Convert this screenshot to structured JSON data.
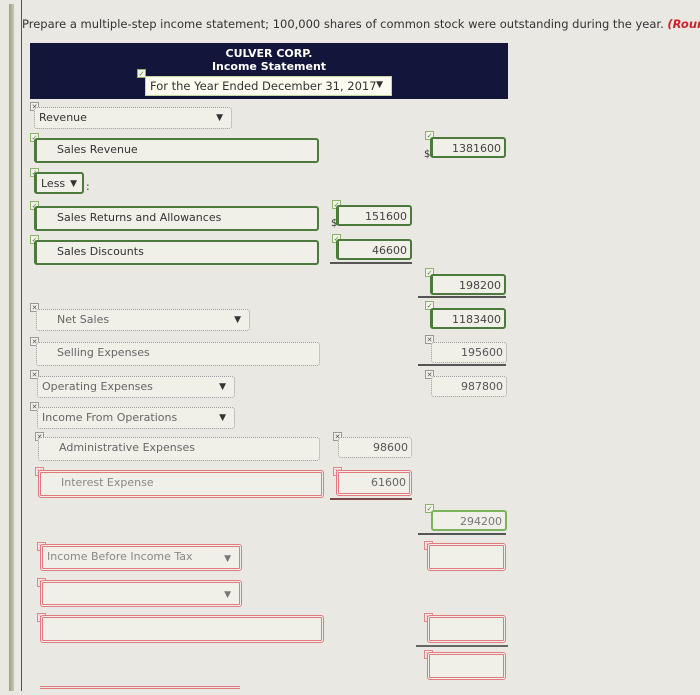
{
  "instructions": {
    "text": "Prepare a multiple-step income statement; 100,000 shares of common stock were outstanding during the year.",
    "note": "(Round earni"
  },
  "header": {
    "company": "CULVER CORP.",
    "statement": "Income Statement",
    "period": "For the Year Ended December 31, 2017"
  },
  "rows": {
    "revenue_heading": "Revenue",
    "sales_revenue": {
      "label": "Sales Revenue",
      "amount": "1381600"
    },
    "less": "Less",
    "sales_returns": {
      "label": "Sales Returns and Allowances",
      "amount": "151600"
    },
    "sales_discounts": {
      "label": "Sales Discounts",
      "amount": "46600"
    },
    "subtotal_deductions": "198200",
    "net_sales": {
      "label": "Net Sales",
      "amount": "1183400"
    },
    "selling_expenses": {
      "label": "Selling Expenses",
      "amount": "195600"
    },
    "operating_expenses": {
      "label": "Operating Expenses",
      "amount": "987800"
    },
    "income_from_operations": {
      "label": "Income From Operations"
    },
    "admin_expenses": {
      "label": "Administrative Expenses",
      "amount": "98600"
    },
    "interest_expense": {
      "label": "Interest Expense",
      "amount": "61600"
    },
    "other_total": "294200",
    "income_before_tax": {
      "label": "Income Before Income Tax",
      "amount": ""
    },
    "blank_select": {
      "label": "",
      "amount": ""
    },
    "blank_field": {
      "label": "",
      "amount": ""
    },
    "blank_amount_final": ""
  },
  "icons": {
    "check": "✓",
    "cross": "✕",
    "dropdown": "▼",
    "dollar": "$"
  }
}
